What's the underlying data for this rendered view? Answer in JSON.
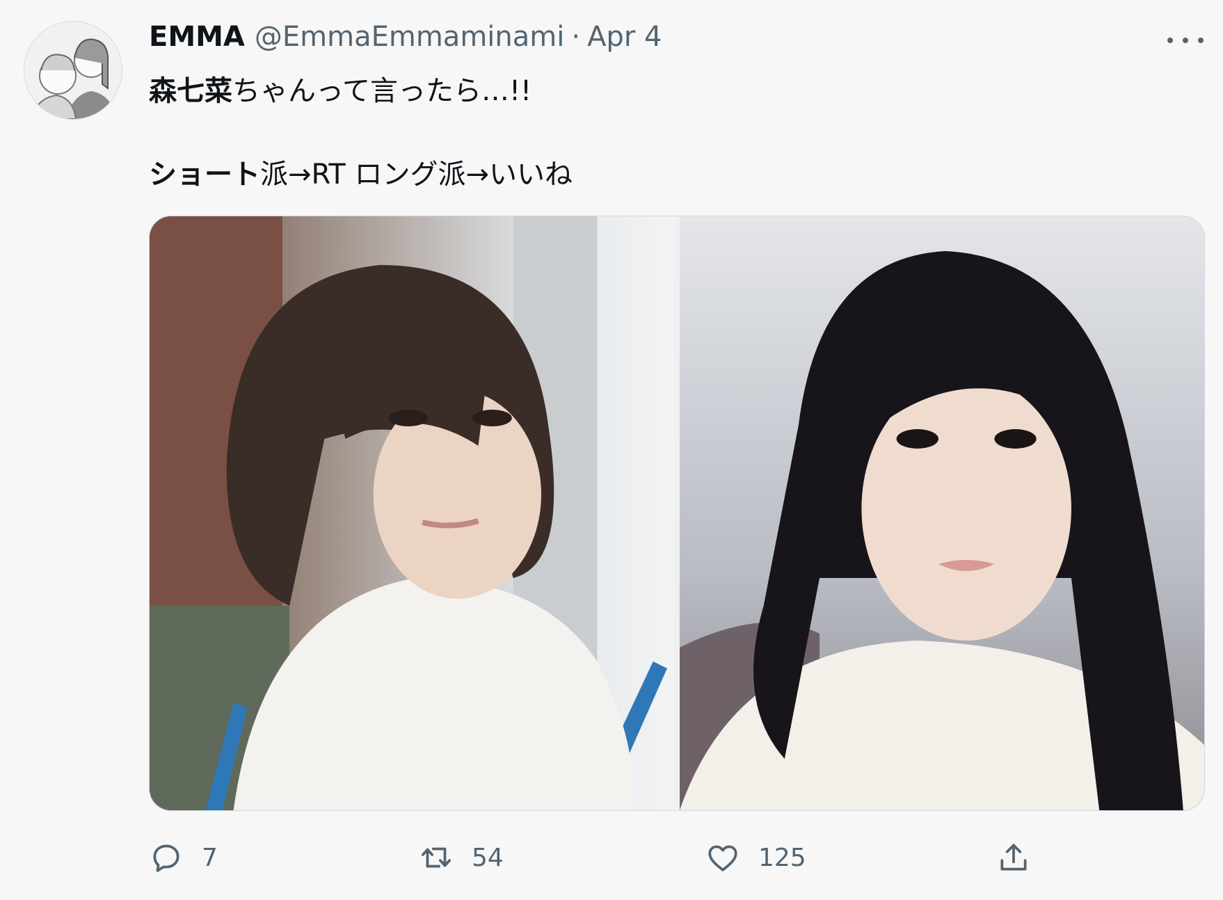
{
  "tweet": {
    "author_name": "EMMA",
    "author_handle": "@EmmaEmmaminami",
    "separator": "·",
    "date": "Apr 4",
    "line1_bold": "森七菜",
    "line1_rest": "ちゃんって言ったら…!!",
    "line2_bold": "ショート",
    "line2_rest": "派→RT ロング派→いいね"
  },
  "media": [
    {
      "icon": "photo-short-hair"
    },
    {
      "icon": "photo-long-hair"
    }
  ],
  "actions": {
    "reply_count": "7",
    "retweet_count": "54",
    "like_count": "125"
  },
  "colors": {
    "background": "#f7f7f7",
    "text_primary": "#0f1419",
    "text_secondary": "#536471",
    "border": "#cfd9de"
  }
}
